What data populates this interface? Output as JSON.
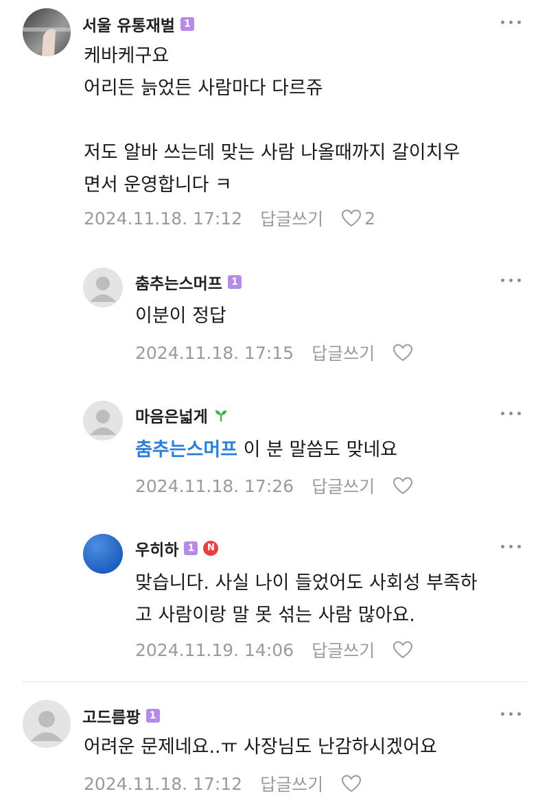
{
  "comments": [
    {
      "author": "서울 유통재벌",
      "level": "1",
      "lines": [
        "케바케구요",
        "어리든 늙었든 사람마다 다르쥬",
        "",
        "저도 알바 쓰는데 맞는 사람 나올때까지 갈이치우",
        "면서 운영합니다 ㅋ"
      ],
      "date": "2024.11.18. 17:12",
      "reply_label": "답글쓰기",
      "likes": "2"
    },
    {
      "author": "춤추는스머프",
      "level": "1",
      "lines": [
        "이분이 정답"
      ],
      "date": "2024.11.18. 17:15",
      "reply_label": "답글쓰기"
    },
    {
      "author": "마음은넓게",
      "mention": "춤추는스머프",
      "text": " 이 분 말씀도 맞네요",
      "date": "2024.11.18. 17:26",
      "reply_label": "답글쓰기"
    },
    {
      "author": "우히하",
      "level": "1",
      "badge": "N",
      "lines": [
        "맞습니다. 사실 나이 들었어도 사회성 부족하",
        "고 사람이랑 말 못 섞는 사람 많아요."
      ],
      "date": "2024.11.19. 14:06",
      "reply_label": "답글쓰기"
    },
    {
      "author": "고드름팡",
      "level": "1",
      "lines": [
        "어려운 문제네요..ㅠ 사장님도 난감하시겠어요"
      ],
      "date": "2024.11.18. 17:12",
      "reply_label": "답글쓰기"
    }
  ],
  "colors": {
    "level_badge": "#b58ae8",
    "mention": "#2a7fdc",
    "meta": "#9a9a9a",
    "new_badge": "#e8403d"
  },
  "icons": {
    "more": "more-dots-icon",
    "like": "heart-outline-icon",
    "sprout": "sprout-icon"
  }
}
